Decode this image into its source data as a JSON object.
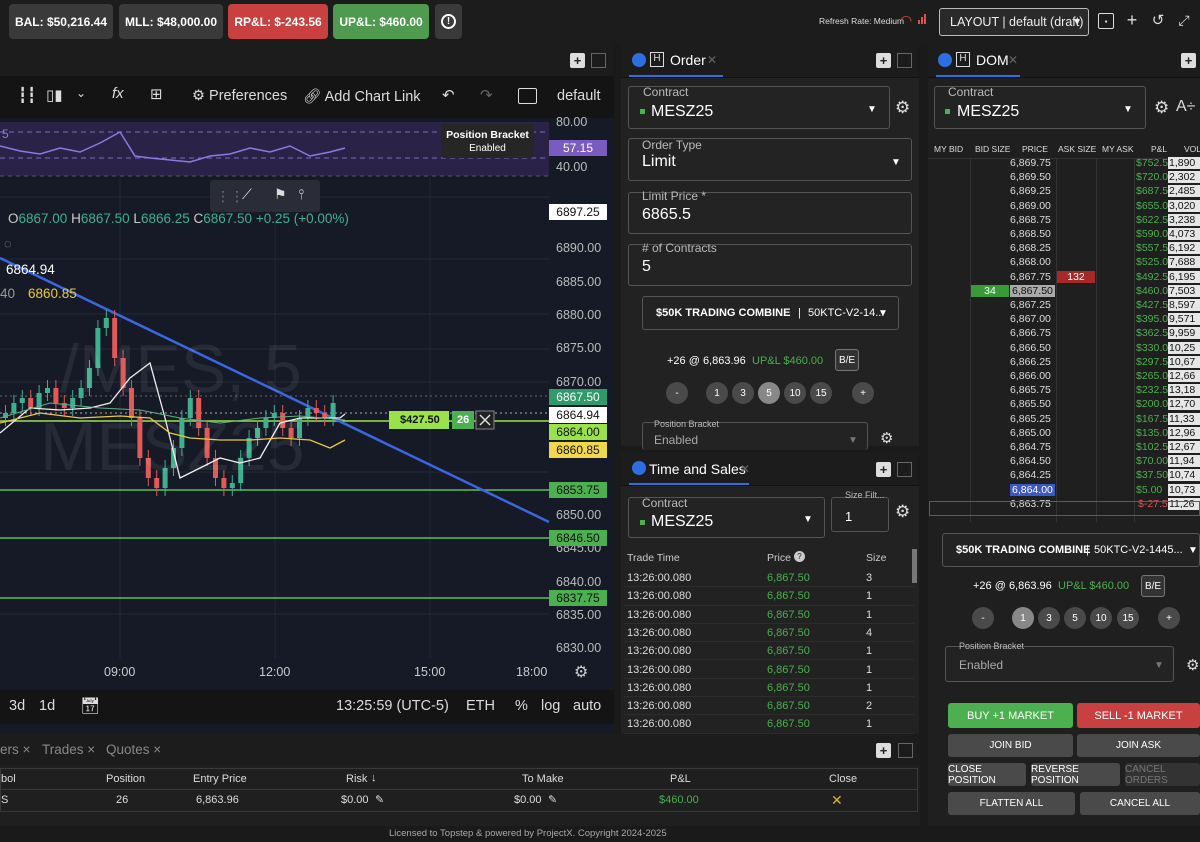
{
  "topbar": {
    "bal": "BAL: $50,216.44",
    "mll": "MLL: $48,000.00",
    "rpl": "RP&L: $-243.56",
    "upl": "UP&L: $460.00",
    "refresh": "Refresh Rate: Medium",
    "layout": "LAYOUT | default (draft)"
  },
  "chart": {
    "toolbar": {
      "preferences": "Preferences",
      "add_link": "Add Chart Link",
      "default": "default"
    },
    "bracket_tip": {
      "title": "Position Bracket",
      "state": "Enabled"
    },
    "ohlc": {
      "o": "O",
      "o_val": "6867.00",
      "h": "H",
      "h_val": "6867.50",
      "l": "L",
      "l_val": "6866.25",
      "c": "C",
      "c_val": "6867.50",
      "chg": "+0.25 (+0.00%)"
    },
    "watermark1": "/MES, 5",
    "watermark2": "MESZ25",
    "ind_vals": {
      "v1": "6864.94",
      "v2_prefix": "40",
      "v2": "6860.85",
      "osc": "5"
    },
    "axis": [
      "80.00",
      "40.00",
      "6890.00",
      "6885.00",
      "6880.00",
      "6875.00",
      "6870.00",
      "6850.00",
      "6845.00",
      "6840.00",
      "6835.00",
      "6830.00"
    ],
    "price_tags": {
      "p1": "57.15",
      "p2": "6897.25",
      "p3": "6867.50",
      "p4": "6864.94",
      "p5": "6864.00",
      "p6": "6860.85",
      "p7": "6853.75",
      "p8": "6846.50",
      "p9": "6837.75"
    },
    "position_tag": {
      "pnl": "$427.50",
      "qty": "26"
    },
    "time_labels": [
      "09:00",
      "12:00",
      "15:00",
      "18:00"
    ],
    "bottom": {
      "d3": "3d",
      "d1": "1d",
      "clock": "13:25:59 (UTC-5)",
      "eth": "ETH",
      "pct": "%",
      "log": "log",
      "auto": "auto"
    }
  },
  "order": {
    "title": "Order",
    "contract_label": "Contract",
    "contract": "MESZ25",
    "type_label": "Order Type",
    "type": "Limit",
    "limit_label": "Limit Price *",
    "limit": "6865.5",
    "contracts_label": "# of Contracts",
    "contracts": "5",
    "account": "$50K TRADING COMBINE",
    "account_id": "50KTC-V2-14...",
    "position": "+26 @ 6,863.96",
    "upl": "UP&L $460.00",
    "be": "B/E",
    "qty": [
      "-",
      "1",
      "3",
      "5",
      "10",
      "15",
      "+"
    ],
    "bracket_label": "Position Bracket",
    "bracket": "Enabled"
  },
  "tas": {
    "title": "Time and Sales",
    "contract_label": "Contract",
    "contract": "MESZ25",
    "size_label": "Size Filt...",
    "size": "1",
    "h_time": "Trade Time",
    "h_price": "Price",
    "h_size": "Size",
    "rows": [
      {
        "t": "13:26:00.080",
        "p": "6,867.50",
        "s": "3"
      },
      {
        "t": "13:26:00.080",
        "p": "6,867.50",
        "s": "1"
      },
      {
        "t": "13:26:00.080",
        "p": "6,867.50",
        "s": "1"
      },
      {
        "t": "13:26:00.080",
        "p": "6,867.50",
        "s": "4"
      },
      {
        "t": "13:26:00.080",
        "p": "6,867.50",
        "s": "1"
      },
      {
        "t": "13:26:00.080",
        "p": "6,867.50",
        "s": "1"
      },
      {
        "t": "13:26:00.080",
        "p": "6,867.50",
        "s": "1"
      },
      {
        "t": "13:26:00.080",
        "p": "6,867.50",
        "s": "2"
      },
      {
        "t": "13:26:00.080",
        "p": "6,867.50",
        "s": "1"
      }
    ]
  },
  "dom": {
    "title": "DOM",
    "contract_label": "Contract",
    "contract": "MESZ25",
    "headers": [
      "MY BID",
      "BID SIZE",
      "PRICE",
      "ASK SIZE",
      "MY ASK",
      "P&L",
      "VOL"
    ],
    "rows": [
      {
        "price": "6,869.75",
        "pl": "$752.50",
        "vol": "1,890",
        "ask": "",
        "bid": ""
      },
      {
        "price": "6,869.50",
        "pl": "$720.00",
        "vol": "2,302",
        "ask": "",
        "bid": ""
      },
      {
        "price": "6,869.25",
        "pl": "$687.50",
        "vol": "2,485",
        "ask": "",
        "bid": ""
      },
      {
        "price": "6,869.00",
        "pl": "$655.00",
        "vol": "3,020",
        "ask": "",
        "bid": ""
      },
      {
        "price": "6,868.75",
        "pl": "$622.50",
        "vol": "3,238",
        "ask": "",
        "bid": ""
      },
      {
        "price": "6,868.50",
        "pl": "$590.00",
        "vol": "4,073",
        "ask": "",
        "bid": ""
      },
      {
        "price": "6,868.25",
        "pl": "$557.50",
        "vol": "6,192",
        "ask": "",
        "bid": ""
      },
      {
        "price": "6,868.00",
        "pl": "$525.00",
        "vol": "7,688",
        "ask": "",
        "bid": ""
      },
      {
        "price": "6,867.75",
        "pl": "$492.50",
        "vol": "6,195",
        "ask": "132",
        "bid": ""
      },
      {
        "price": "6,867.50",
        "pl": "$460.00",
        "vol": "7,503",
        "ask": "",
        "bid": "34"
      },
      {
        "price": "6,867.25",
        "pl": "$427.50",
        "vol": "8,597",
        "ask": "",
        "bid": ""
      },
      {
        "price": "6,867.00",
        "pl": "$395.00",
        "vol": "9,571",
        "ask": "",
        "bid": ""
      },
      {
        "price": "6,866.75",
        "pl": "$362.50",
        "vol": "9,959",
        "ask": "",
        "bid": ""
      },
      {
        "price": "6,866.50",
        "pl": "$330.00",
        "vol": "10,25",
        "ask": "",
        "bid": ""
      },
      {
        "price": "6,866.25",
        "pl": "$297.50",
        "vol": "10,67",
        "ask": "",
        "bid": ""
      },
      {
        "price": "6,866.00",
        "pl": "$265.00",
        "vol": "12,66",
        "ask": "",
        "bid": ""
      },
      {
        "price": "6,865.75",
        "pl": "$232.50",
        "vol": "13,18",
        "ask": "",
        "bid": ""
      },
      {
        "price": "6,865.50",
        "pl": "$200.00",
        "vol": "12,70",
        "ask": "",
        "bid": ""
      },
      {
        "price": "6,865.25",
        "pl": "$167.50",
        "vol": "11,33",
        "ask": "",
        "bid": ""
      },
      {
        "price": "6,865.00",
        "pl": "$135.00",
        "vol": "12,96",
        "ask": "",
        "bid": ""
      },
      {
        "price": "6,864.75",
        "pl": "$102.50",
        "vol": "12,67",
        "ask": "",
        "bid": ""
      },
      {
        "price": "6,864.50",
        "pl": "$70.00",
        "vol": "11,94",
        "ask": "",
        "bid": ""
      },
      {
        "price": "6,864.25",
        "pl": "$37.50",
        "vol": "10,74",
        "ask": "",
        "bid": ""
      },
      {
        "price": "6,864.00",
        "pl": "$5.00",
        "vol": "10,73",
        "ask": "",
        "bid": ""
      },
      {
        "price": "6,863.75",
        "pl": "$-27.50",
        "vol": "11,26",
        "ask": "",
        "bid": ""
      }
    ],
    "account": "$50K TRADING COMBINE",
    "account_id": "50KTC-V2-1445...",
    "position": "+26 @ 6,863.96",
    "upl": "UP&L $460.00",
    "be": "B/E",
    "qty": [
      "-",
      "1",
      "3",
      "5",
      "10",
      "15",
      "+"
    ],
    "bracket_label": "Position Bracket",
    "bracket": "Enabled",
    "buy": "BUY +1 MARKET",
    "sell": "SELL -1 MARKET",
    "join_bid": "JOIN BID",
    "join_ask": "JOIN ASK",
    "close": "CLOSE POSITION",
    "reverse": "REVERSE POSITION",
    "cancel_orders": "CANCEL ORDERS",
    "flatten": "FLATTEN ALL",
    "cancel_all": "CANCEL ALL"
  },
  "positions": {
    "tabs": [
      "ers",
      "Trades",
      "Quotes"
    ],
    "headers": [
      "bol",
      "Position",
      "Entry Price",
      "Risk",
      "To Make",
      "P&L",
      "Close"
    ],
    "row": {
      "sym": "S",
      "pos": "26",
      "entry": "6,863.96",
      "risk": "$0.00",
      "make": "$0.00",
      "pl": "$460.00"
    }
  },
  "footer": "Licensed to Topstep & powered by ProjectX. Copyright 2024-2025",
  "colors": {
    "green": "#4caf50",
    "red": "#c84040",
    "accent": "#2f6ee0"
  }
}
